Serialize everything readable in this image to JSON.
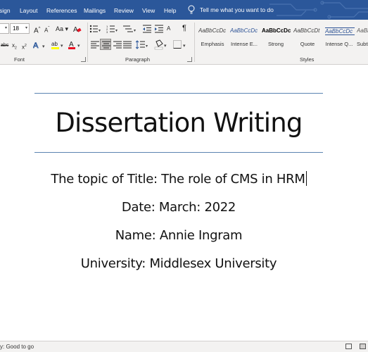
{
  "menu": {
    "tabs": [
      "sign",
      "Layout",
      "References",
      "Mailings",
      "Review",
      "View",
      "Help"
    ],
    "tell_me": "Tell me what you want to do"
  },
  "ribbon": {
    "font_size": "18",
    "groups": {
      "font": "Font",
      "paragraph": "Paragraph",
      "styles": "Styles"
    },
    "styles": [
      {
        "sample": "AaBbCcDc",
        "name": "Emphasis"
      },
      {
        "sample": "AaBbCcDc",
        "name": "Intense E..."
      },
      {
        "sample": "AaBbCcDc",
        "name": "Strong"
      },
      {
        "sample": "AaBbCcDt",
        "name": "Quote"
      },
      {
        "sample": "AaBbCcDc",
        "name": "Intense Q..."
      },
      {
        "sample": "AaBb",
        "name": "Subtl"
      }
    ],
    "style_colors": {
      "emphasis": "#404040",
      "intense_emphasis": "#2f5496",
      "strong": "#000000",
      "quote": "#404040",
      "intense_quote": "#2f5496",
      "subtle": "#595959"
    }
  },
  "document": {
    "title": "Dissertation Writing",
    "lines": [
      "The topic of Title: The role of CMS in HRM",
      "Date: March: 2022",
      "Name: Annie Ingram",
      "University: Middlesex University"
    ]
  },
  "status": {
    "text": "y: Good to go"
  },
  "colors": {
    "brand": "#2b579a",
    "ribbon_bg": "#f3f2f1",
    "rule": "#5b84b1"
  }
}
